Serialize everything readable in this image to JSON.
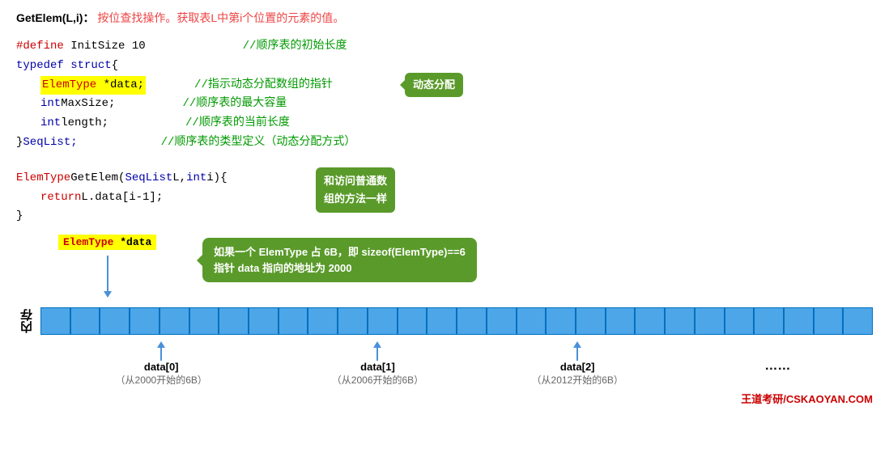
{
  "header": {
    "func_name": "GetElem(L,i)：",
    "desc": "按位查找操作。获取表L中第i个位置的元素的值。"
  },
  "code": {
    "define_line": "#define InitSize 10",
    "define_comment": "//顺序表的初始长度",
    "typedef_line": "typedef struct{",
    "elem_data_line": "    ElemType *data;",
    "elem_data_comment": "//指示动态分配数组的指针",
    "elem_data_tooltip": "动态分配",
    "int_maxsize_line": "    int MaxSize;",
    "int_maxsize_comment": "//顺序表的最大容量",
    "int_length_line": "    int length;",
    "int_length_comment": "//顺序表的当前长度",
    "seqlist_line": "} SeqList;",
    "seqlist_comment": "//顺序表的类型定义（动态分配方式）",
    "getelem_line": "ElemType GetElem(SeqList L, int i){",
    "getelem_tooltip": "和访问普通数\n组的方法一样",
    "return_line": "    return L.data[i-1];",
    "close_brace": "}",
    "elemtype_data": "ElemType *data",
    "elemtype_tooltip": "如果一个 ElemType 占 6B，即 sizeof(ElemType)==6\n指针 data 指向的地址为 2000"
  },
  "memory": {
    "label": "内存",
    "cells_count": 28,
    "annotations": [
      {
        "id": "data0",
        "label": "data[0]",
        "sub": "（从2000开始的6B）",
        "left_pct": 9
      },
      {
        "id": "data1",
        "label": "data[1]",
        "sub": "（从2006开始的6B）",
        "left_pct": 36
      },
      {
        "id": "data2",
        "label": "data[2]",
        "sub": "（从2012开始的6B）",
        "left_pct": 60
      },
      {
        "id": "dotdot",
        "label": "……",
        "sub": "",
        "left_pct": 88
      }
    ]
  },
  "watermark": "王道考研/CSKAOYAN.COM"
}
